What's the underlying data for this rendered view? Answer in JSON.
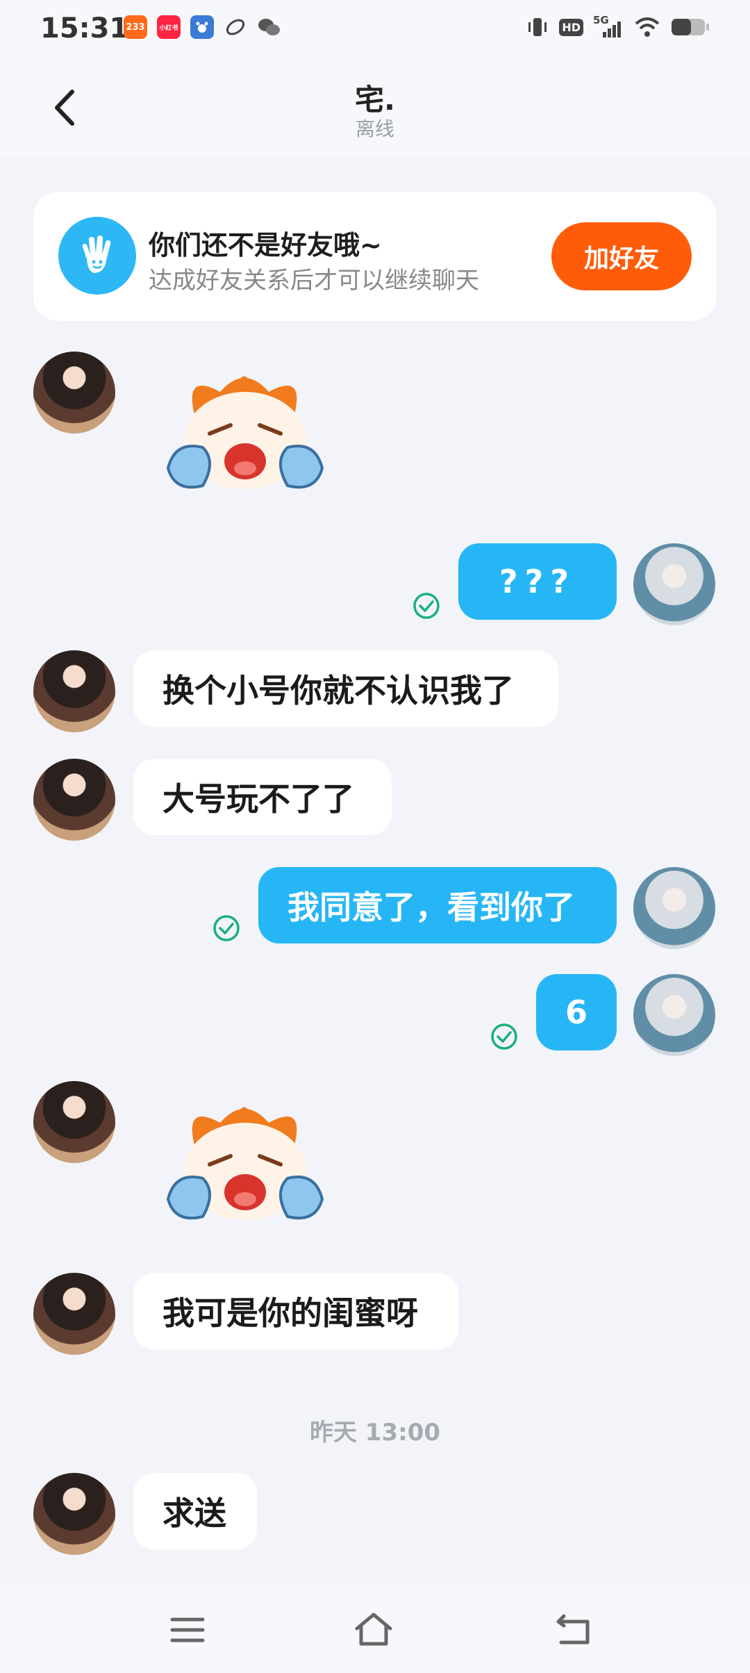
{
  "status_bar": {
    "time": "15:31",
    "apps": [
      {
        "icon": "233-app-icon",
        "text": "233",
        "color": "#ff6a1a"
      },
      {
        "icon": "xiaohongshu-icon",
        "text": "小红书",
        "color": "#ff2442"
      },
      {
        "icon": "baidu-icon",
        "text": "",
        "color": "#3a7bd5"
      },
      {
        "icon": "link-icon",
        "text": "",
        "color": "#444444"
      },
      {
        "icon": "wechat-icon",
        "text": "",
        "color": "#444444"
      }
    ],
    "hd_badge": "HD",
    "network": "5G"
  },
  "header": {
    "title": "宅.",
    "status": "离线"
  },
  "friend_banner": {
    "title": "你们还不是好友哦~",
    "subtitle": "达成好友关系后才可以继续聊天",
    "button": "加好友"
  },
  "messages": [
    {
      "from": "them",
      "kind": "sticker",
      "sticker": "crying-sticker"
    },
    {
      "from": "me",
      "kind": "text",
      "text": "???",
      "read": true
    },
    {
      "from": "them",
      "kind": "text",
      "text": "换个小号你就不认识我了"
    },
    {
      "from": "them",
      "kind": "text",
      "text": "大号玩不了了"
    },
    {
      "from": "me",
      "kind": "text",
      "text": "我同意了，看到你了",
      "read": true
    },
    {
      "from": "me",
      "kind": "text",
      "text": "6",
      "read": true
    },
    {
      "from": "them",
      "kind": "sticker",
      "sticker": "crying-sticker"
    },
    {
      "from": "them",
      "kind": "text",
      "text": "我可是你的闺蜜呀"
    },
    {
      "from": "them",
      "kind": "text",
      "text": "求送"
    }
  ],
  "timestamp": "昨天 13:00",
  "colors": {
    "outgoing_bubble": "#27b6f5",
    "incoming_bubble": "#ffffff",
    "add_friend": "#ff5c0a",
    "read_check": "#19b07a",
    "background": "#f2f4f9"
  },
  "nav_bar": {
    "icons": [
      "menu-icon",
      "home-icon",
      "back-nav-icon"
    ]
  }
}
